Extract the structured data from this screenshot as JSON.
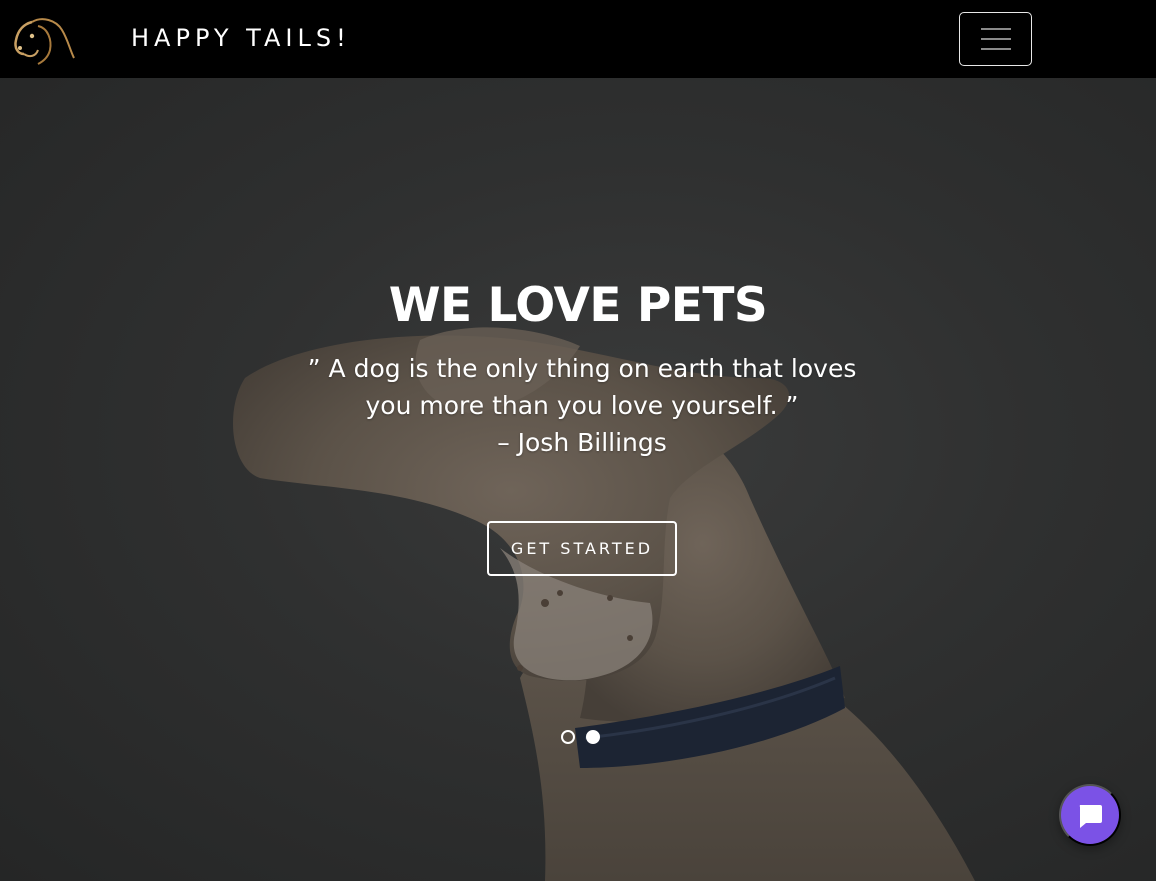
{
  "navbar": {
    "brand": "HAPPY TAILS!",
    "logo_icon": "dog-head-logo-icon",
    "menu_icon": "hamburger-menu-icon"
  },
  "hero": {
    "title": "WE LOVE PETS",
    "quote_line1": "” A dog is the only thing on earth that loves",
    "quote_line2": "you more than you love yourself. ”",
    "author": "– Josh Billings",
    "cta_label": "GET STARTED",
    "carousel": {
      "slides": 2,
      "active_index": 2
    }
  },
  "chat": {
    "icon": "chat-bubble-icon",
    "color": "#7b52e6"
  },
  "colors": {
    "navbar_bg": "#000000",
    "text": "#ffffff",
    "accent": "#7b52e6"
  }
}
